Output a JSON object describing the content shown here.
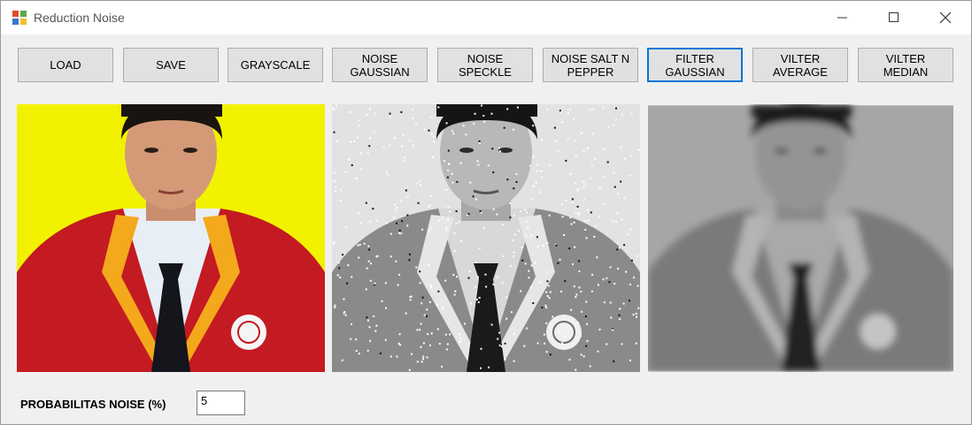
{
  "window": {
    "title": "Reduction Noise"
  },
  "toolbar": {
    "buttons": [
      {
        "label": "LOAD"
      },
      {
        "label": "SAVE"
      },
      {
        "label": "GRAYSCALE"
      },
      {
        "label": "NOISE\nGAUSSIAN"
      },
      {
        "label": "NOISE\nSPECKLE"
      },
      {
        "label": "NOISE SALT N\nPEPPER"
      },
      {
        "label": "FILTER\nGAUSSIAN"
      },
      {
        "label": "VILTER\nAVERAGE"
      },
      {
        "label": "VILTER\nMEDIAN"
      }
    ]
  },
  "images": {
    "original": "color photo",
    "noisy": "grayscale salt and pepper",
    "filtered": "blurred grayscale"
  },
  "noise": {
    "label": "PROBABILITAS NOISE (%)",
    "value": "5"
  },
  "colors": {
    "focus": "#0078d7",
    "background_yellow": "#f2f200",
    "jacket_red": "#c41a22",
    "lapel_gold": "#f4a81c"
  }
}
